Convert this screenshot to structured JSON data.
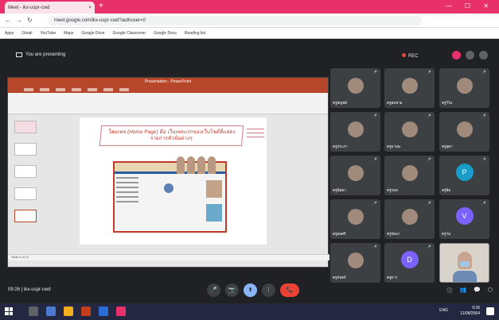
{
  "browser": {
    "tab_title": "Meet - ikx-uspr-cwd",
    "tab_close": "×",
    "new_tab": "+",
    "window_controls": "— ☐ ✕",
    "url": "meet.google.com/ikx-uspr-cwd?authuser=0",
    "bookmarks": [
      "Apps",
      "Gmail",
      "YouTube",
      "Maps",
      "Google Drive",
      "Google Classroom",
      "Google Docs",
      "Reading list"
    ]
  },
  "meet": {
    "presenting_label": "You are presenting",
    "recording_label": "REC",
    "meeting_info": "09:26 | ikx-uspr-cwd",
    "controls": [
      "🎤",
      "📷",
      "⬆",
      "⋮",
      "📞"
    ],
    "right_controls": [
      "ⓘ",
      "👥",
      "💬",
      "⬡"
    ],
    "participants": [
      {
        "name": "ครูอัญชลี",
        "type": "photo"
      },
      {
        "name": "ครูสมชาย",
        "type": "photo"
      },
      {
        "name": "ครูวิไล",
        "type": "photo"
      },
      {
        "name": "ครูประภา",
        "type": "photo"
      },
      {
        "name": "ครูมานพ",
        "type": "photo"
      },
      {
        "name": "ครูสุดา",
        "type": "photo"
      },
      {
        "name": "ครูนิตยา",
        "type": "photo"
      },
      {
        "name": "ครูกมล",
        "type": "photo"
      },
      {
        "name": "ครูพิม",
        "type": "avatar",
        "initial": "P",
        "color": "#1a9cc9"
      },
      {
        "name": "ครูสมศรี",
        "type": "photo"
      },
      {
        "name": "ครูรัตนา",
        "type": "photo"
      },
      {
        "name": "ครูวัน",
        "type": "avatar",
        "initial": "V",
        "color": "#7b61ff"
      },
      {
        "name": "ครูจันทร์",
        "type": "photo"
      },
      {
        "name": "ครูดาว",
        "type": "avatar",
        "initial": "D",
        "color": "#7b61ff"
      }
    ],
    "mic_icon": "🎤"
  },
  "slide": {
    "banner_text": "โฮมเพจ (Home Page) คือ เว็บเพจแรกของเว็บไซต์ที่แสดงรายการหัวข้อต่างๆ",
    "window_title": "Presentation - PowerPoint",
    "status_text": "Slide 5 of 12"
  },
  "taskbar": {
    "tray": "ENG",
    "time": "9:26",
    "date": "11/08/2564"
  },
  "colors": {
    "tab_bar": "#e8306a",
    "ppt_accent": "#b7472a",
    "end_call": "#ea4335",
    "taskbar": "#232840"
  }
}
